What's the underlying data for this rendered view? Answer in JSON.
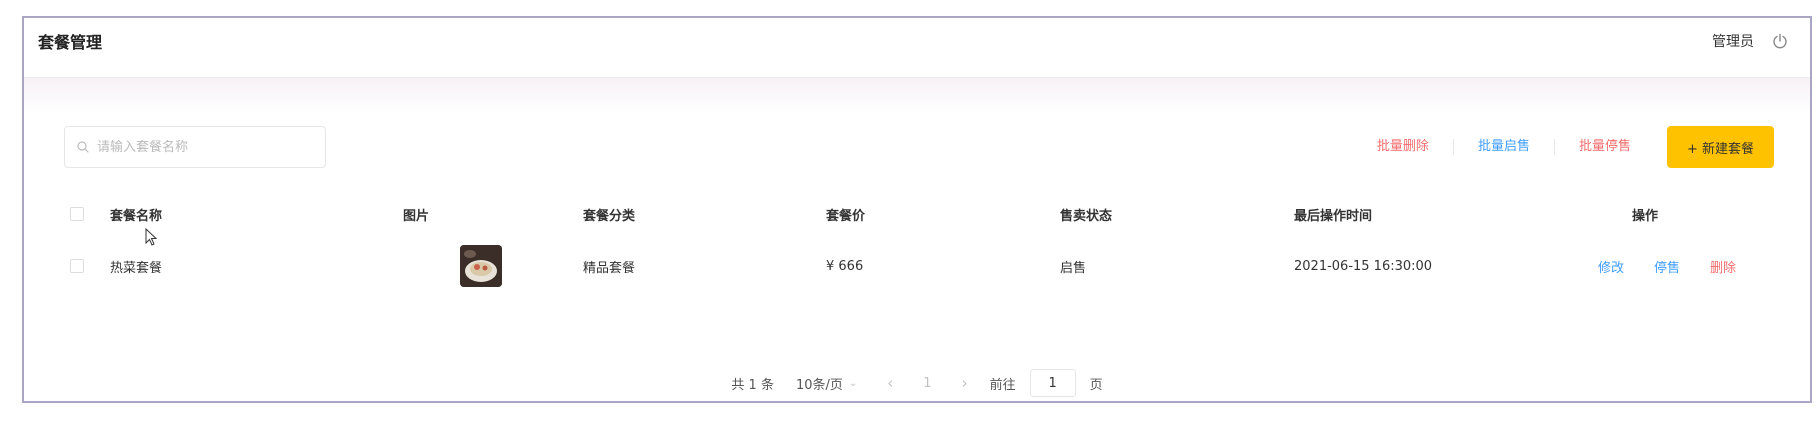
{
  "header": {
    "title": "套餐管理",
    "user_name": "管理员",
    "power_icon": "power-icon"
  },
  "toolbar": {
    "search_placeholder": "请输入套餐名称",
    "batch_delete": "批量删除",
    "batch_start_sale": "批量启售",
    "batch_stop_sale": "批量停售",
    "new_button": "+ 新建套餐"
  },
  "colors": {
    "accent": "#ffc200",
    "danger_link": "#f56c6c",
    "primary_link": "#409eff",
    "frame_border": "#a9a6c4"
  },
  "table": {
    "columns": [
      "套餐名称",
      "图片",
      "套餐分类",
      "套餐价",
      "售卖状态",
      "最后操作时间",
      "操作"
    ],
    "rows": [
      {
        "name": "热菜套餐",
        "image": "dish-photo",
        "category": "精品套餐",
        "price": "¥ 666",
        "status": "启售",
        "updated": "2021-06-15 16:30:00",
        "actions": [
          "修改",
          "停售",
          "删除"
        ]
      }
    ]
  },
  "pagination": {
    "total_text": "共 1 条",
    "page_size": "10条/页",
    "current_page": "1",
    "goto_label": "前往",
    "goto_value": "1",
    "page_suffix": "页"
  }
}
